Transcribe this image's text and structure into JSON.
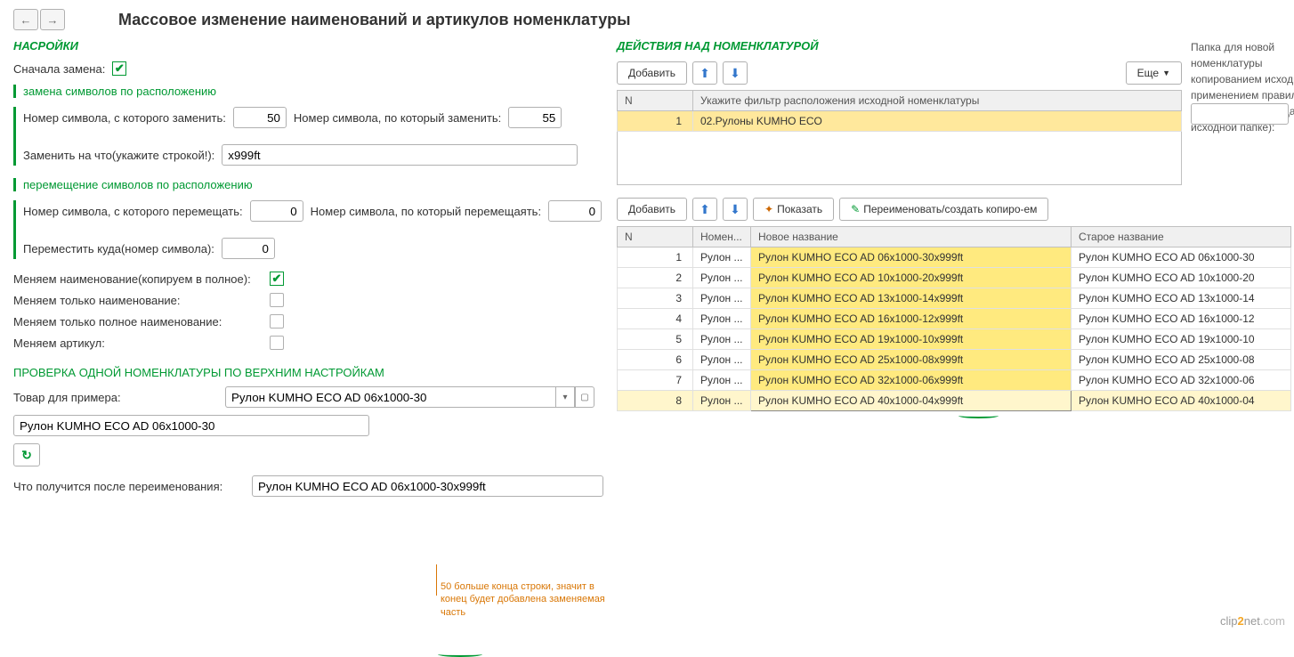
{
  "title": "Массовое изменение наименований и артикулов номенклатуры",
  "settings": {
    "header": "НАСРОЙКИ",
    "first_replace": "Сначала замена:",
    "replace_section": "замена символов по расположению",
    "num_from_label": "Номер символа, с которого заменить:",
    "num_from": "50",
    "num_to_label": "Номер символа, по который заменить:",
    "num_to": "55",
    "replace_with_label": "Заменить на что(укажите строкой!):",
    "replace_with": "x999ft",
    "move_section": "перемещение символов по расположению",
    "move_from_label": "Номер символа, с которого перемещать:",
    "move_from": "0",
    "move_to_label": "Номер символа, по который перемещаять:",
    "move_to": "0",
    "move_dest_label": "Переместить куда(номер символа):",
    "move_dest": "0",
    "chk_copy_full": "Меняем наименование(копируем в полное):",
    "chk_only_name": "Меняем только наименование:",
    "chk_only_full": "Меняем только полное наименование:",
    "chk_article": "Меняем артикул:"
  },
  "verify": {
    "header": "ПРОВЕРКА ОДНОЙ НОМЕНКЛАТУРЫ ПО ВЕРХНИМ НАСТРОЙКАМ",
    "sample_label": "Товар для примера:",
    "sample_value": "Рулон KUMHO ECO AD 06x1000-30",
    "example_value": "Рулон KUMHO ECO AD 06x1000-30",
    "result_label": "Что получится после переименования:",
    "result_value": "Рулон KUMHO ECO AD 06x1000-30x999ft"
  },
  "annotation1": "50 больше конца строки, значит в конец будет добавлена заменяемая часть",
  "actions": {
    "header": "ДЕЙСТВИЯ НАД НОМЕНКЛАТУРОЙ",
    "add": "Добавить",
    "more": "Еще",
    "show": "Показать",
    "rename": "Переименовать/создать копиро-ем",
    "side_text": "Папка для новой номенклатуры копированием исходной с применением правил(если не заполнено - создается в исходной папке):"
  },
  "filter": {
    "col_n": "N",
    "col_desc": "Укажите фильтр расположения исходной номенклатуры",
    "rows": [
      {
        "n": "1",
        "v": "02.Рулоны KUMHO ECO"
      }
    ]
  },
  "grid": {
    "col_n": "N",
    "col_nom": "Номен...",
    "col_new": "Новое название",
    "col_old": "Старое название",
    "rows": [
      {
        "n": "1",
        "nom": "Рулон ...",
        "new": "Рулон KUMHO ECO AD 06x1000-30x999ft",
        "old": "Рулон KUMHO ECO AD 06x1000-30"
      },
      {
        "n": "2",
        "nom": "Рулон ...",
        "new": "Рулон KUMHO ECO AD 10x1000-20x999ft",
        "old": "Рулон KUMHO ECO AD 10x1000-20"
      },
      {
        "n": "3",
        "nom": "Рулон ...",
        "new": "Рулон KUMHO ECO AD 13x1000-14x999ft",
        "old": "Рулон KUMHO ECO AD 13x1000-14"
      },
      {
        "n": "4",
        "nom": "Рулон ...",
        "new": "Рулон KUMHO ECO AD 16x1000-12x999ft",
        "old": "Рулон KUMHO ECO AD 16x1000-12"
      },
      {
        "n": "5",
        "nom": "Рулон ...",
        "new": "Рулон KUMHO ECO AD 19x1000-10x999ft",
        "old": "Рулон KUMHO ECO AD 19x1000-10"
      },
      {
        "n": "6",
        "nom": "Рулон ...",
        "new": "Рулон KUMHO ECO AD 25x1000-08x999ft",
        "old": "Рулон KUMHO ECO AD 25x1000-08"
      },
      {
        "n": "7",
        "nom": "Рулон ...",
        "new": "Рулон KUMHO ECO AD 32x1000-06x999ft",
        "old": "Рулон KUMHO ECO AD 32x1000-06"
      },
      {
        "n": "8",
        "nom": "Рулон ...",
        "new": "Рулон KUMHO ECO AD 40x1000-04x999ft",
        "old": "Рулон KUMHO ECO AD 40x1000-04"
      }
    ]
  },
  "watermark": {
    "a": "clip",
    "b": "2",
    "c": "net",
    "d": ".com"
  }
}
